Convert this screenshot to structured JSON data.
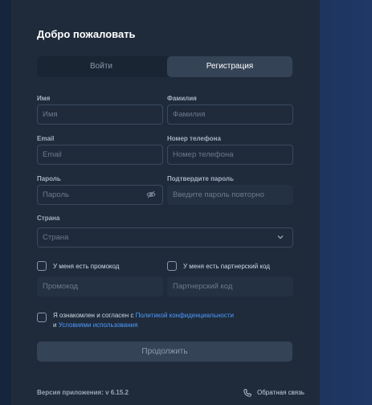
{
  "title": "Добро пожаловать",
  "tabs": {
    "login": "Войти",
    "register": "Регистрация"
  },
  "form": {
    "first_name": {
      "label": "Имя",
      "placeholder": "Имя"
    },
    "last_name": {
      "label": "Фамилия",
      "placeholder": "Фамилия"
    },
    "email": {
      "label": "Email",
      "placeholder": "Email"
    },
    "phone": {
      "label": "Номер телефона",
      "placeholder": "Номер телефона"
    },
    "password": {
      "label": "Пароль",
      "placeholder": "Пароль"
    },
    "confirm_password": {
      "label": "Подтвердите пароль",
      "placeholder": "Введите пароль повторно"
    },
    "country": {
      "label": "Страна",
      "placeholder": "Страна"
    },
    "promo": {
      "checkbox_label": "У меня есть промокод",
      "placeholder": "Промокод"
    },
    "partner": {
      "checkbox_label": "У меня есть партнерский код",
      "placeholder": "Партнерский код"
    },
    "consent": {
      "prefix": "Я ознакомлен и согласен с",
      "privacy_link": "Политикой конфиденциальности",
      "and": "и",
      "terms_link": "Условиями использования"
    },
    "continue_label": "Продолжить"
  },
  "footer": {
    "version": "Версия приложения: v 6.15.2",
    "feedback": "Обратная связь"
  },
  "colors": {
    "panel": "#1f2b3b",
    "active_tab": "#344356",
    "link": "#4d9bff",
    "input_border": "#3a4a5e"
  },
  "icons": {
    "password_toggle": "eye-off-icon",
    "country_dropdown": "chevron-down-icon",
    "feedback": "phone-icon"
  }
}
